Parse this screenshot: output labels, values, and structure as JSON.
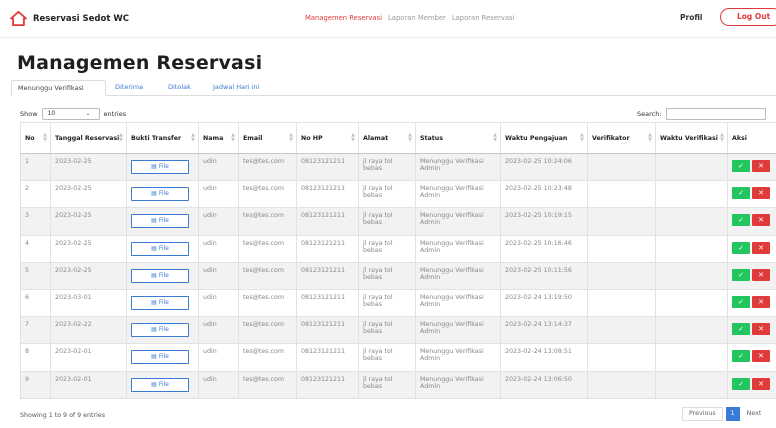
{
  "header": {
    "brand": "Reservasi Sedot WC",
    "nav": [
      {
        "label": "Managemen Reservasi",
        "active": true
      },
      {
        "label": "Laporan Member",
        "active": false
      },
      {
        "label": "Laporan Reservasi",
        "active": false
      }
    ],
    "profil": "Profil",
    "logout": "Log Out"
  },
  "page_title": "Managemen Reservasi",
  "tabs": [
    "Menunggu Verifikasi",
    "Diterima",
    "Ditolak",
    "Jadwal Hari ini"
  ],
  "controls": {
    "show_label": "Show",
    "show_value": "10",
    "entries_label": "entries",
    "search_label": "Search:"
  },
  "table": {
    "columns": [
      "No",
      "Tanggal Reservasi",
      "Bukti Transfer",
      "Nama",
      "Email",
      "No HP",
      "Alamat",
      "Status",
      "Waktu Pengajuan",
      "Verifikator",
      "Waktu Verifikasi",
      "Aksi"
    ],
    "file_label": "File",
    "rows": [
      {
        "no": "1",
        "tanggal": "2023-02-25",
        "nama": "udin",
        "email": "tes@tes.com",
        "hp": "08123121211",
        "alamat": "jl raya tol bebas",
        "status": "Menunggu Verifikasi Admin",
        "waktu": "2023-02-25 10:24:06",
        "verifikator": "",
        "waktu_verifikasi": ""
      },
      {
        "no": "2",
        "tanggal": "2023-02-25",
        "nama": "udin",
        "email": "tes@tes.com",
        "hp": "08123121211",
        "alamat": "jl raya tol bebas",
        "status": "Menunggu Verifikasi Admin",
        "waktu": "2023-02-25 10:23:48",
        "verifikator": "",
        "waktu_verifikasi": ""
      },
      {
        "no": "3",
        "tanggal": "2023-02-25",
        "nama": "udin",
        "email": "tes@tes.com",
        "hp": "08123121211",
        "alamat": "jl raya tol bebas",
        "status": "Menunggu Verifikasi Admin",
        "waktu": "2023-02-25 10:19:15",
        "verifikator": "",
        "waktu_verifikasi": ""
      },
      {
        "no": "4",
        "tanggal": "2023-02-25",
        "nama": "udin",
        "email": "tes@tes.com",
        "hp": "08123121211",
        "alamat": "jl raya tol bebas",
        "status": "Menunggu Verifikasi Admin",
        "waktu": "2023-02-25 10:16:46",
        "verifikator": "",
        "waktu_verifikasi": ""
      },
      {
        "no": "5",
        "tanggal": "2023-02-25",
        "nama": "udin",
        "email": "tes@tes.com",
        "hp": "08123121211",
        "alamat": "jl raya tol bebas",
        "status": "Menunggu Verifikasi Admin",
        "waktu": "2023-02-25 10:11:56",
        "verifikator": "",
        "waktu_verifikasi": ""
      },
      {
        "no": "6",
        "tanggal": "2023-03-01",
        "nama": "udin",
        "email": "tes@tes.com",
        "hp": "08123121211",
        "alamat": "jl raya tol bebas",
        "status": "Menunggu Verifikasi Admin",
        "waktu": "2023-02-24 13:19:50",
        "verifikator": "",
        "waktu_verifikasi": ""
      },
      {
        "no": "7",
        "tanggal": "2023-02-22",
        "nama": "udin",
        "email": "tes@tes.com",
        "hp": "08123121211",
        "alamat": "jl raya tol bebas",
        "status": "Menunggu Verifikasi Admin",
        "waktu": "2023-02-24 13:14:37",
        "verifikator": "",
        "waktu_verifikasi": ""
      },
      {
        "no": "8",
        "tanggal": "2023-02-01",
        "nama": "udin",
        "email": "tes@tes.com",
        "hp": "08123121211",
        "alamat": "jl raya tol bebas",
        "status": "Menunggu Verifikasi Admin",
        "waktu": "2023-02-24 13:08:51",
        "verifikator": "",
        "waktu_verifikasi": ""
      },
      {
        "no": "9",
        "tanggal": "2023-02-01",
        "nama": "udin",
        "email": "tes@tes.com",
        "hp": "08123121211",
        "alamat": "jl raya tol bebas",
        "status": "Menunggu Verifikasi Admin",
        "waktu": "2023-02-24 13:06:50",
        "verifikator": "",
        "waktu_verifikasi": ""
      }
    ]
  },
  "footer": {
    "info": "Showing 1 to 9 of 9 entries",
    "prev": "Previous",
    "page": "1",
    "next": "Next"
  },
  "colors": {
    "accent_red": "#e03b3b",
    "link_blue": "#3a7bd5",
    "approve_green": "#22c55e"
  },
  "icons": {
    "brand": "house-icon",
    "file": "file-icon",
    "approve": "check-icon",
    "reject": "x-icon"
  }
}
